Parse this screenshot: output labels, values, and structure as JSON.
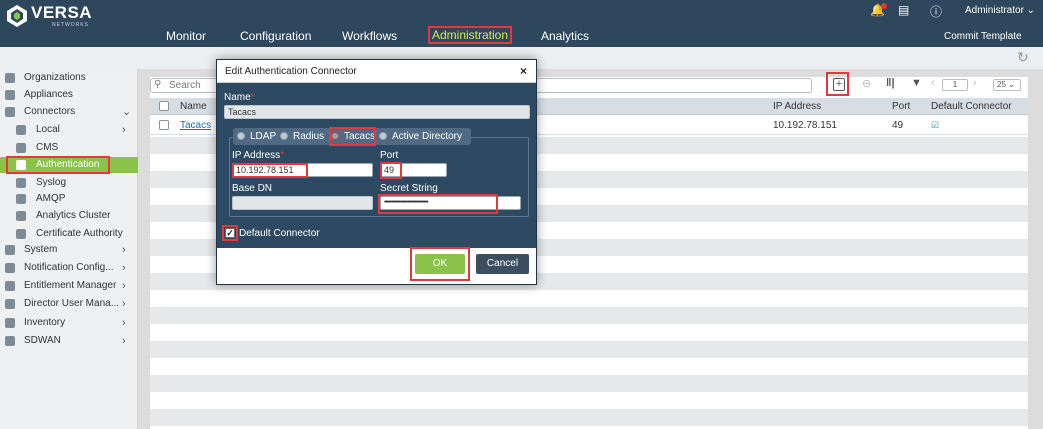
{
  "brand": {
    "name": "VERSA",
    "sub": "NETWORKS"
  },
  "top_nav": [
    "Monitor",
    "Configuration",
    "Workflows",
    "Administration",
    "Analytics"
  ],
  "user": {
    "name": "Administrator",
    "badge": "0"
  },
  "commit_label": "Commit Template",
  "icons": {
    "logo": "versa-logo-icon",
    "bell": "bell-icon",
    "doc": "document-icon",
    "info": "info-icon",
    "refresh": "refresh-icon",
    "search": "search-icon",
    "add": "add-icon",
    "columns": "columns-icon",
    "filter": "filter-icon"
  },
  "sidebar": {
    "items": [
      {
        "label": "Organizations",
        "icon": "organizations-icon"
      },
      {
        "label": "Appliances",
        "icon": "appliances-icon"
      },
      {
        "label": "Connectors",
        "icon": "connectors-icon",
        "expanded": true
      },
      {
        "label": "Local",
        "icon": "local-icon"
      },
      {
        "label": "CMS",
        "icon": "cms-icon"
      },
      {
        "label": "Authentication",
        "icon": "authentication-icon",
        "active": true
      },
      {
        "label": "Syslog",
        "icon": "syslog-icon"
      },
      {
        "label": "AMQP",
        "icon": "amqp-icon"
      },
      {
        "label": "Analytics Cluster",
        "icon": "analytics-cluster-icon"
      },
      {
        "label": "Certificate Authority",
        "icon": "certificate-icon"
      },
      {
        "label": "System",
        "icon": "system-icon"
      },
      {
        "label": "Notification Config...",
        "icon": "notification-icon"
      },
      {
        "label": "Entitlement Manager",
        "icon": "entitlement-icon"
      },
      {
        "label": "Director User Mana...",
        "icon": "users-icon"
      },
      {
        "label": "Inventory",
        "icon": "inventory-icon"
      },
      {
        "label": "SDWAN",
        "icon": "sdwan-icon"
      }
    ]
  },
  "search": {
    "placeholder": "Search"
  },
  "pager": {
    "page": "1",
    "per_page": "25"
  },
  "table": {
    "headers": [
      "Name",
      "IP Address",
      "Port",
      "Default Connector"
    ],
    "rows": [
      {
        "name": "Tacacs",
        "ip": "10.192.78.151",
        "port": "49"
      }
    ]
  },
  "modal": {
    "title": "Edit Authentication Connector",
    "close": "×",
    "name_label": "Name",
    "name_value": "Tacacs",
    "types": [
      "LDAP",
      "Radius",
      "Tacacs",
      "Active Directory"
    ],
    "selected_type": "Tacacs",
    "ip_label": "IP Address",
    "ip_value": "10.192.78.151",
    "port_label": "Port",
    "port_value": "49",
    "basedn_label": "Base DN",
    "secret_label": "Secret String",
    "secret_value": "••••••••••••••••••••••••••••••",
    "default_label": "Default Connector",
    "default_checked": true,
    "ok": "OK",
    "cancel": "Cancel"
  },
  "colors": {
    "header": "#2f475c",
    "accent": "#8bc34a",
    "highlight": "#e0393e",
    "modal": "#2e4a62"
  }
}
